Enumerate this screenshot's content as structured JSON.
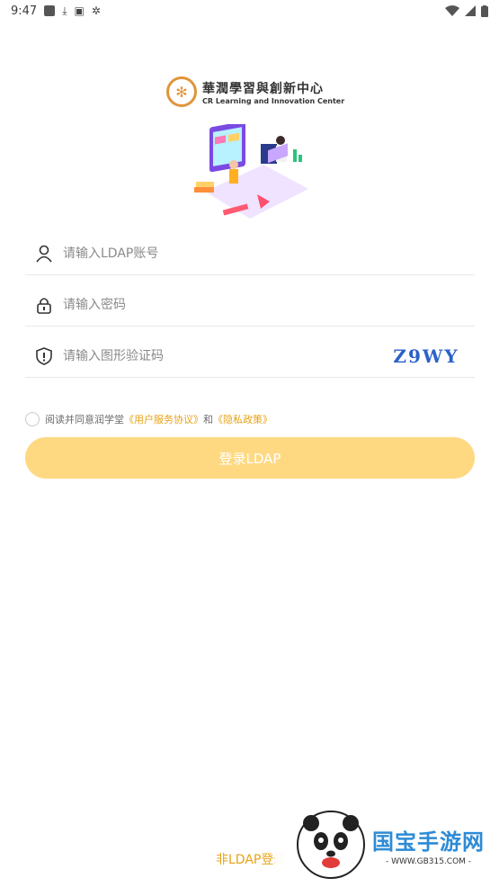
{
  "status_bar": {
    "time": "9:47"
  },
  "logo": {
    "cn_name": "華潤學習與創新中心",
    "en_name": "CR Learning and Innovation Center"
  },
  "form": {
    "account_placeholder": "请输入LDAP账号",
    "password_placeholder": "请输入密码",
    "captcha_placeholder": "请输入图形验证码",
    "captcha_text": "Z9WY"
  },
  "agreement": {
    "prefix": "阅读并同意润学堂",
    "user_agreement": "《用户服务协议》",
    "and": "和",
    "privacy_policy": "《隐私政策》"
  },
  "login_button": "登录LDAP",
  "alt_login": "非LDAP登录",
  "watermark": {
    "title": "国宝手游网",
    "url": "- WWW.GB315.COM -"
  },
  "colors": {
    "accent": "#e6a317",
    "button_bg": "#fed982",
    "logo_orange": "#e0953a"
  }
}
